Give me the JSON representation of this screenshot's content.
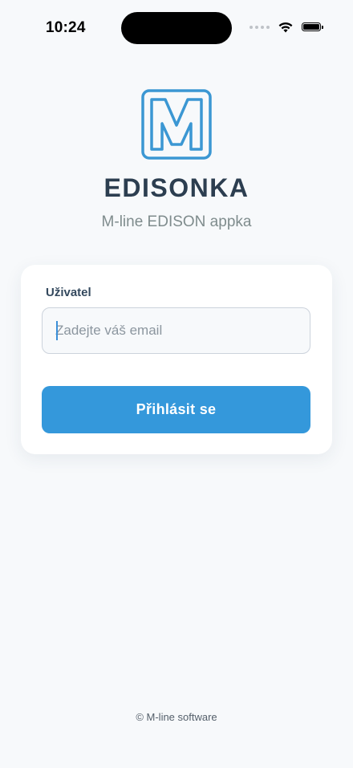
{
  "status_bar": {
    "time": "10:24",
    "icons": [
      "cellular-signal-icon",
      "wifi-icon",
      "battery-icon"
    ],
    "battery_level": 1.0
  },
  "branding": {
    "logo_icon": "m-logo-icon",
    "logo_color": "#3498db",
    "title": "EDISONKA",
    "subtitle": "M-line EDISON appka"
  },
  "login_form": {
    "user_label": "Uživatel",
    "email_placeholder": "Zadejte váš email",
    "email_value": "",
    "submit_label": "Přihlásit se",
    "accent_color": "#3498db"
  },
  "footer": {
    "text": "© M-line software"
  }
}
